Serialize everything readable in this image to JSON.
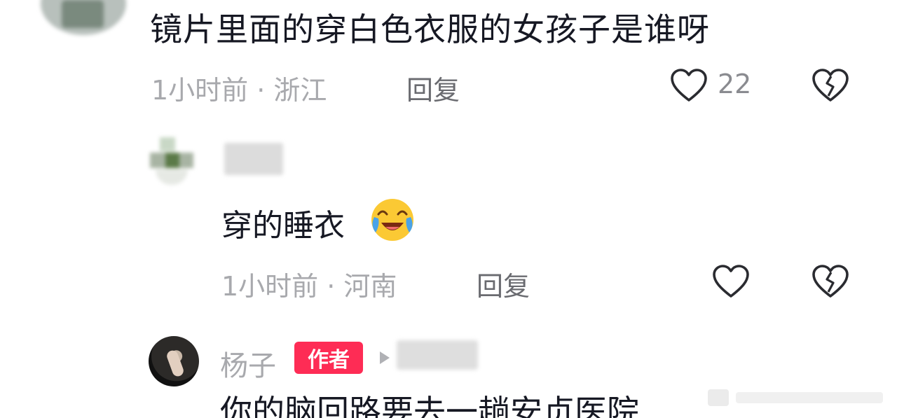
{
  "comments": [
    {
      "text": "镜片里面的穿白色衣服的女孩子是谁呀",
      "time": "1小时前 · 浙江",
      "reply_label": "回复",
      "like_count": "22"
    },
    {
      "text": "穿的睡衣",
      "emoji": "crying-laughing-face",
      "time": "1小时前 · 河南",
      "reply_label": "回复"
    },
    {
      "author_name": "杨子",
      "author_badge": "作者",
      "text": "你的脑回路要去一趟安贞医院"
    }
  ],
  "colors": {
    "text_primary": "#161823",
    "text_meta": "#a8a9ad",
    "badge": "#fe2c55"
  }
}
